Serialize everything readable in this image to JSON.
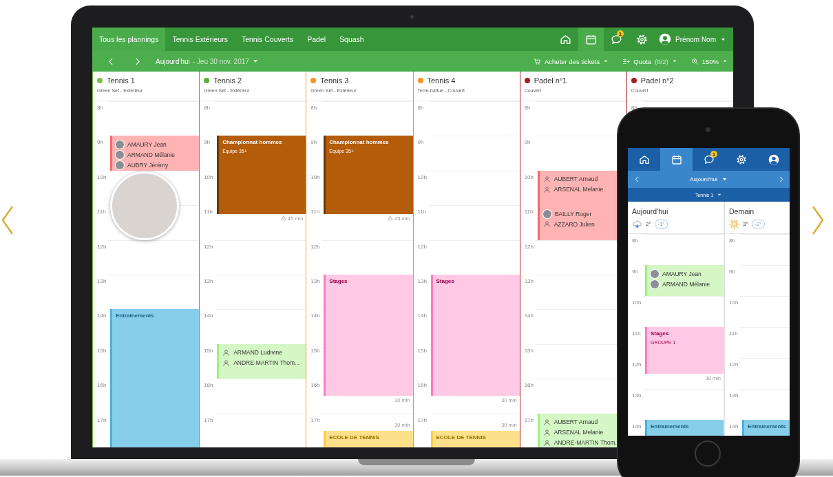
{
  "laptop": {
    "tabs": [
      {
        "label": "Tous les plannings",
        "selected": true
      },
      {
        "label": "Tennis Extérieurs",
        "selected": false
      },
      {
        "label": "Tennis Couverts",
        "selected": false
      },
      {
        "label": "Padel",
        "selected": false
      },
      {
        "label": "Squash",
        "selected": false
      }
    ],
    "nav_icons": [
      {
        "kind": "home",
        "selected": false
      },
      {
        "kind": "calendar",
        "selected": true
      },
      {
        "kind": "chat",
        "selected": false,
        "badge": "1"
      },
      {
        "kind": "settings",
        "selected": false
      }
    ],
    "user": {
      "name": "Prénom Nom"
    },
    "toolbar": {
      "date_today": "Aujourd'hui",
      "date_rest": "- Jeu 30 nov. 2017",
      "actions": [
        {
          "kind": "cart",
          "label": "Acheter des tickets"
        },
        {
          "kind": "quota",
          "label": "Quota",
          "count": "(0/2)"
        },
        {
          "kind": "zoom",
          "label": "150%"
        }
      ]
    },
    "columns": [
      {
        "name": "Tennis 1",
        "surface": "Green Set - Extérieur",
        "color": "#7ac143",
        "photo": true,
        "hours": [
          "8h",
          "9h",
          "10h",
          "11h",
          "12h",
          "13h",
          "14h",
          "15h",
          "16h",
          "17h"
        ],
        "events": [
          {
            "kind": "people",
            "color": "#ffb3b3",
            "people": [
              {
                "name": "AMAURY Jean",
                "kind": "photo"
              },
              {
                "name": "ARMAND Mélanie",
                "kind": "photo"
              },
              {
                "name": "AUBRY Jérémy",
                "kind": "photo"
              }
            ]
          },
          {
            "kind": "title",
            "color": "#87ceeb",
            "title": "Entrainements"
          }
        ]
      },
      {
        "name": "Tennis 2",
        "surface": "Green Set - Extérieur",
        "color": "#5cae3a",
        "hours": [
          "8h",
          "9h",
          "10h",
          "11h",
          "12h",
          "13h",
          "14h",
          "15h",
          "16h",
          "17h"
        ],
        "events": [
          {
            "kind": "title",
            "color": "#b35c0a",
            "title": "Championnat hommes",
            "subtitle": "Equipe 35+",
            "note_after": {
              "text": "45 min",
              "warning": true
            }
          },
          {
            "kind": "people",
            "color": "#d4f7c5",
            "people": [
              {
                "name": "ARMAND Ludivine",
                "kind": "person"
              },
              {
                "name": "ANDRE-MARTIN Thom...",
                "kind": "person"
              }
            ]
          }
        ]
      },
      {
        "name": "Tennis 3",
        "surface": "Green Set - Extérieur",
        "color": "#f7931e",
        "hours": [
          "8h",
          "9h",
          "10h",
          "11h",
          "12h",
          "13h",
          "14h",
          "15h",
          "16h",
          "17h"
        ],
        "events": [
          {
            "kind": "title",
            "color": "#b35c0a",
            "title": "Championnat hommes",
            "subtitle": "Equipe 35+",
            "note_after": {
              "text": "45 min",
              "warning": true
            }
          },
          {
            "kind": "title",
            "color": "#ffc8e4",
            "title": "Stages",
            "note_after": {
              "text": "30 min"
            }
          },
          {
            "kind": "title",
            "color": "#fde08a",
            "title": "ECOLE DE TENNIS",
            "note_before": {
              "text": "30 min"
            }
          }
        ]
      },
      {
        "name": "Tennis 4",
        "surface": "Terre-battue - Couvert",
        "color": "#f7931e",
        "hours": [
          "8h",
          "9h",
          "10h",
          "11h",
          "12h",
          "13h",
          "14h",
          "15h",
          "16h",
          "17h"
        ],
        "events": [
          {
            "kind": "title",
            "color": "#ffc8e4",
            "title": "Stages",
            "note_after": {
              "text": "30 min"
            }
          },
          {
            "kind": "title",
            "color": "#fde08a",
            "title": "ECOLE DE TENNIS",
            "note_before": {
              "text": "30 min"
            }
          }
        ]
      },
      {
        "name": "Padel n°1",
        "surface": "Couvert",
        "color": "#a51e22",
        "hours": [
          "8h",
          "9h",
          "10h",
          "11h",
          "12h",
          "13h",
          "14h",
          "15h",
          "16h",
          "17h"
        ],
        "events": [
          {
            "kind": "people",
            "color": "#ffb3b3",
            "people": [
              {
                "name": "AUBERT Arnaud",
                "kind": "person"
              },
              {
                "name": "ARSENAL Melanie",
                "kind": "person"
              }
            ]
          },
          {
            "kind": "people",
            "color": "#ffb3b3",
            "people": [
              {
                "name": "BAILLY Roger",
                "kind": "photo"
              },
              {
                "name": "AZZARO Julien",
                "kind": "person"
              }
            ]
          },
          {
            "kind": "people",
            "color": "#d4f7c5",
            "people": [
              {
                "name": "AUBERT Arnaud",
                "kind": "person"
              },
              {
                "name": "ARSENAL Melanie",
                "kind": "person"
              },
              {
                "name": "ANDRE-MARTIN Thom.",
                "kind": "person"
              }
            ]
          }
        ]
      },
      {
        "name": "Padel n°2",
        "surface": "Couvert",
        "color": "#a51e22",
        "hours": [
          "8h"
        ]
      }
    ]
  },
  "phone": {
    "tabs": [
      {
        "kind": "home",
        "selected": false
      },
      {
        "kind": "calendar",
        "selected": true
      },
      {
        "kind": "chat",
        "selected": false,
        "badge": "1"
      },
      {
        "kind": "settings",
        "selected": false
      },
      {
        "kind": "user",
        "selected": false
      }
    ],
    "date": "Aujourd'hui",
    "court": "Tennis 1",
    "days": [
      {
        "label": "Aujourd'hui",
        "weather": {
          "kind": "snow"
        },
        "temp": "2°",
        "feel": "-1°",
        "hours": [
          "8h",
          "9h",
          "10h",
          "11h",
          "12h",
          "13h",
          "14h"
        ],
        "events": [
          {
            "kind": "people",
            "color": "#d4f7c5",
            "people": [
              {
                "name": "AMAURY Jean",
                "kind": "photo"
              },
              {
                "name": "ARMAND Mélanie",
                "kind": "photo"
              }
            ]
          },
          {
            "kind": "title",
            "color": "#ffc8e4",
            "title": "Stages",
            "subtitle": "GROUPE 1",
            "note_after": {
              "text": "30 min"
            }
          },
          {
            "kind": "title",
            "color": "#87ceeb",
            "title": "Entrainements"
          }
        ]
      },
      {
        "label": "Demain",
        "weather": {
          "kind": "sun"
        },
        "temp": "3°",
        "feel": "-2°",
        "hours": [
          "8h",
          "9h",
          "10h",
          "11h",
          "12h",
          "13h",
          "14h"
        ],
        "events": [
          {
            "kind": "title",
            "color": "#87ceeb",
            "title": "Entrainements"
          }
        ]
      }
    ]
  }
}
